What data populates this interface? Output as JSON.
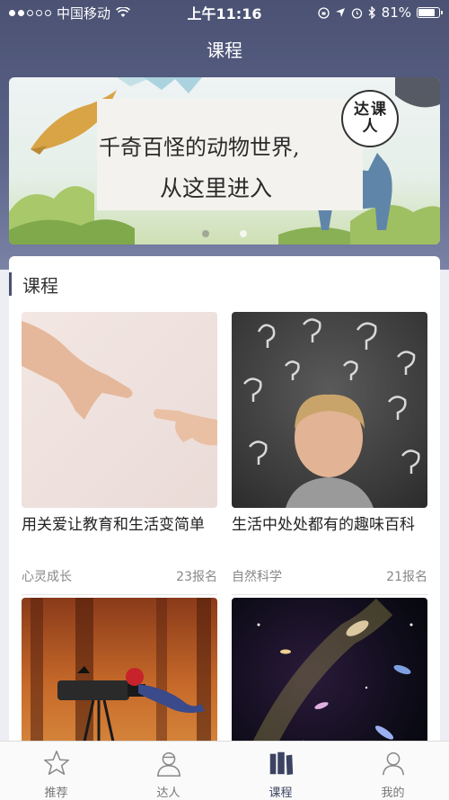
{
  "status_bar": {
    "carrier": "中国移动",
    "time": "上午11:16",
    "battery_percent": "81%",
    "battery_level": 0.81
  },
  "nav": {
    "title": "课程"
  },
  "banner": {
    "line1": "千奇百怪的动物世界,",
    "line2": "从这里进入",
    "stamp_chars": [
      "达",
      "课",
      "人"
    ],
    "active_slide": 1,
    "slide_count": 2
  },
  "section": {
    "title": "课程"
  },
  "courses": [
    {
      "title": "用关爱让教育和生活变简单",
      "category": "心灵成长",
      "enrolled": "23报名",
      "image": "touching-hands"
    },
    {
      "title": "生活中处处都有的趣味百科",
      "category": "自然科学",
      "enrolled": "21报名",
      "image": "boy-question-marks"
    },
    {
      "title": "",
      "category": "",
      "enrolled": "",
      "image": "telescope-forest"
    },
    {
      "title": "",
      "category": "",
      "enrolled": "",
      "image": "galaxy-space"
    }
  ],
  "tabbar": {
    "items": [
      {
        "label": "推荐",
        "icon": "star-icon",
        "active": false
      },
      {
        "label": "达人",
        "icon": "person-icon",
        "active": false
      },
      {
        "label": "课程",
        "icon": "books-icon",
        "active": true
      },
      {
        "label": "我的",
        "icon": "profile-icon",
        "active": false
      }
    ]
  },
  "colors": {
    "header": "#4b5273",
    "accent": "#3c4262"
  }
}
